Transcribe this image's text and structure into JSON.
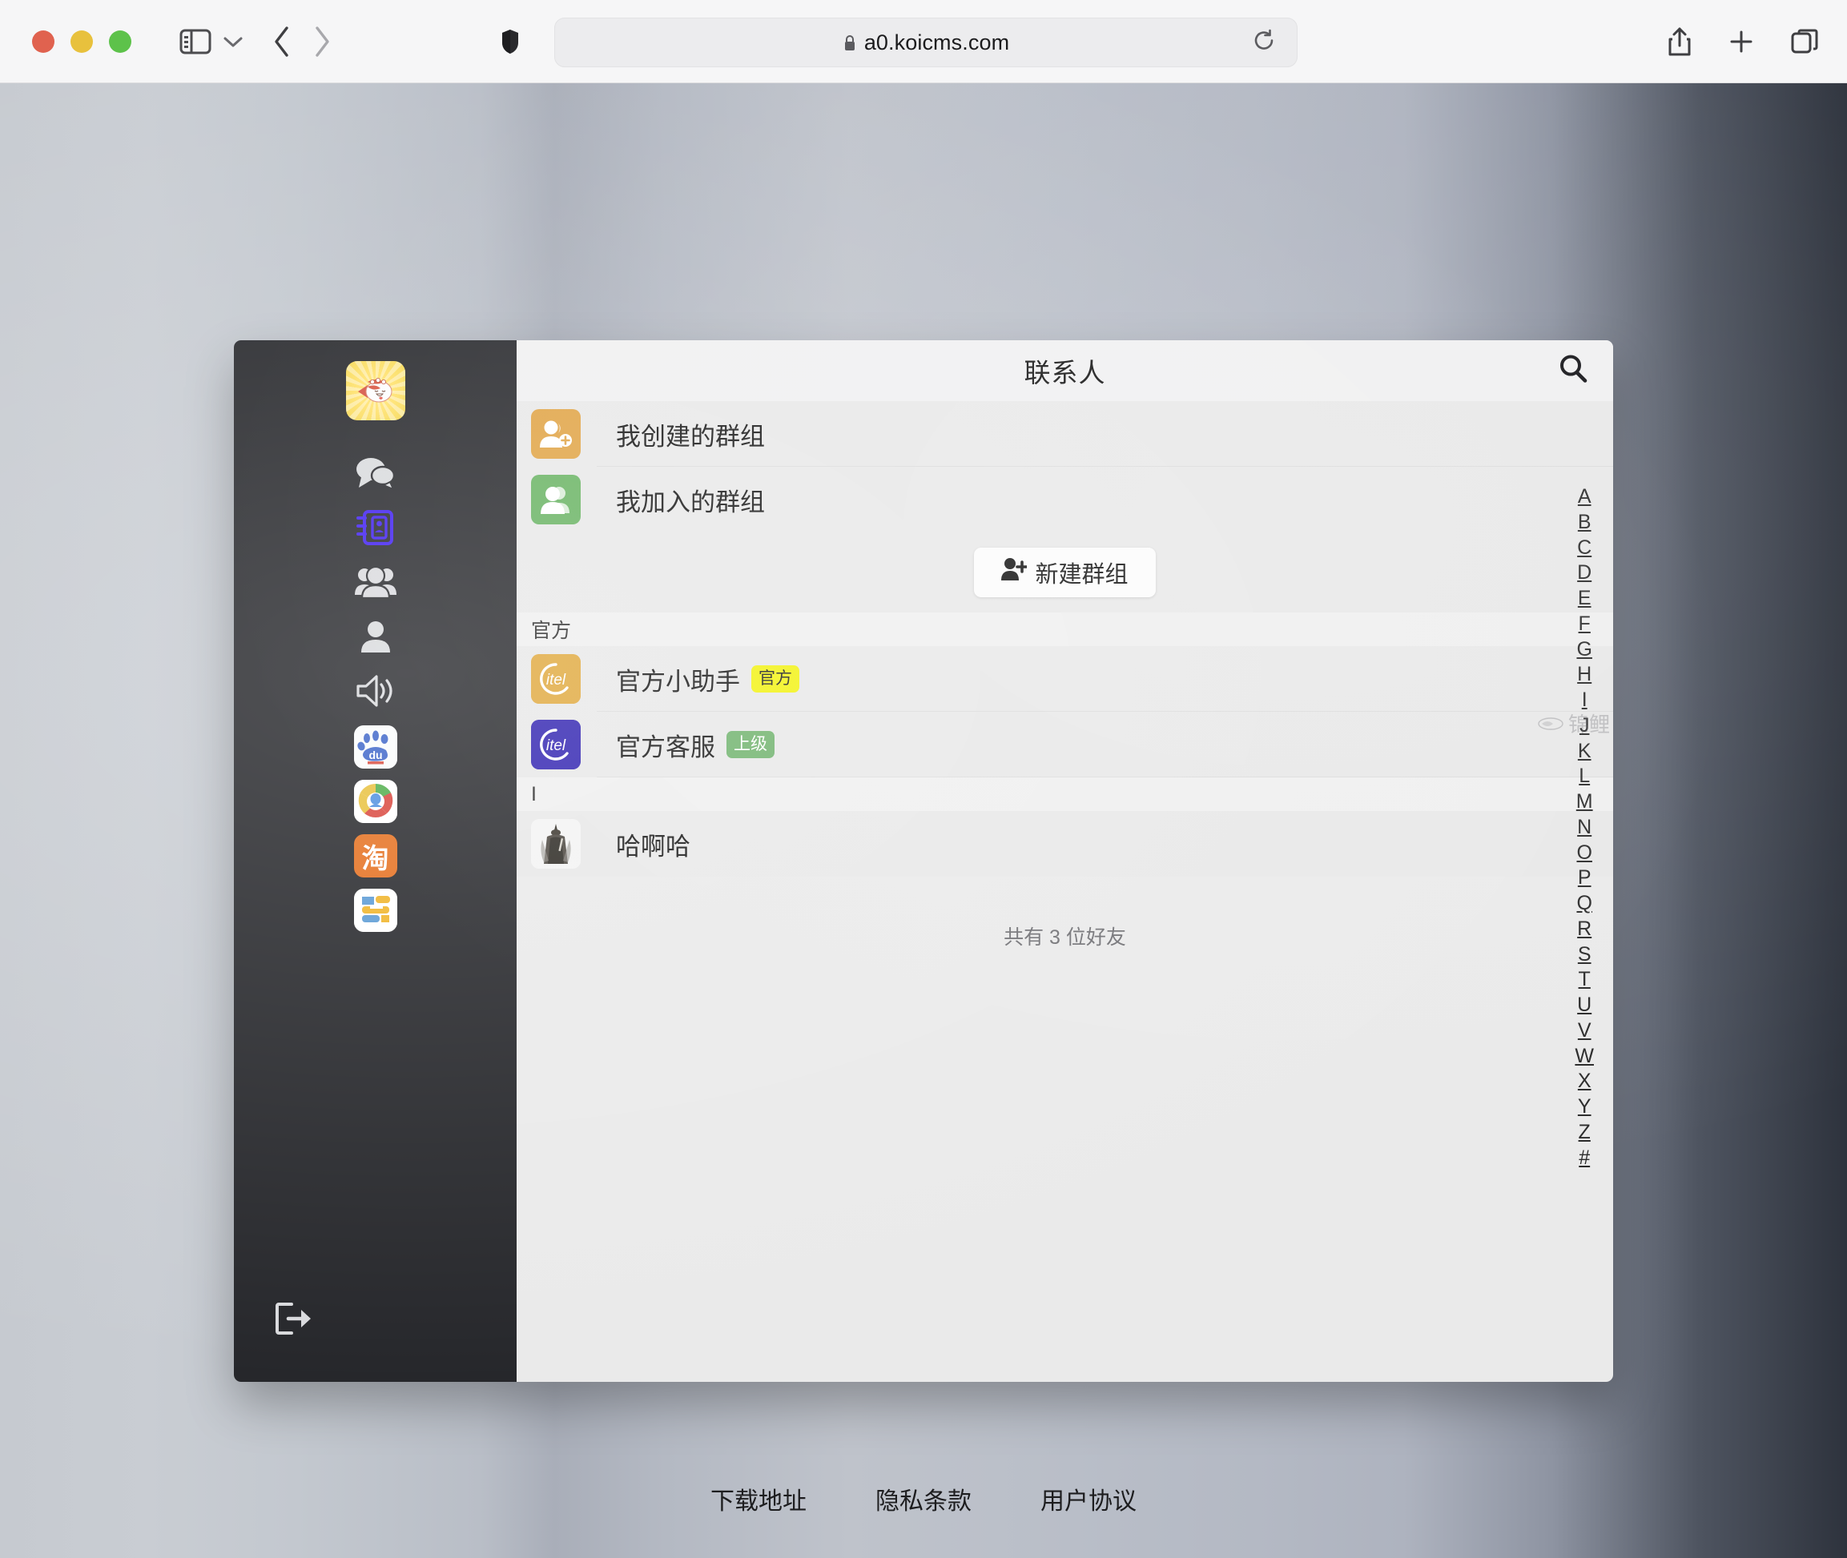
{
  "browser": {
    "url": "a0.koicms.com",
    "lock_icon": "lock-icon",
    "reload_icon": "reload-icon",
    "shield_icon": "shield-icon",
    "sidebar_icon": "sidebar-toggle-icon",
    "back_icon": "back-arrow-icon",
    "forward_icon": "forward-arrow-icon",
    "share_icon": "share-icon",
    "new_tab_icon": "plus-icon",
    "tabs_icon": "tab-overview-icon",
    "traffic_lights": [
      "close-button",
      "minimize-button",
      "zoom-button"
    ]
  },
  "app": {
    "rail": {
      "avatar_name": "koi-fish-avatar",
      "items": [
        {
          "name": "chat-icon",
          "active": false
        },
        {
          "name": "contacts-book-icon",
          "active": true
        },
        {
          "name": "group-icon",
          "active": false
        },
        {
          "name": "profile-icon",
          "active": false
        },
        {
          "name": "speaker-icon",
          "active": false
        }
      ],
      "apps": [
        {
          "name": "baidu-app-icon",
          "label": "du"
        },
        {
          "name": "qq-browser-app-icon",
          "label": ""
        },
        {
          "name": "taobao-app-icon",
          "label": "淘"
        },
        {
          "name": "sina-app-icon",
          "label": ""
        }
      ],
      "logout_icon": "logout-icon"
    },
    "header": {
      "title": "联系人",
      "search_icon": "search-icon"
    },
    "groups": [
      {
        "label": "我创建的群组",
        "avatar": "user-add-icon",
        "color": "orange"
      },
      {
        "label": "我加入的群组",
        "avatar": "users-icon",
        "color": "green"
      }
    ],
    "new_group_button": "新建群组",
    "sections": [
      {
        "heading": "官方",
        "contacts": [
          {
            "name": "官方小助手",
            "badge": "官方",
            "badge_style": "yellow",
            "avatar": "itel-gold-logo"
          },
          {
            "name": "官方客服",
            "badge": "上级",
            "badge_style": "green",
            "avatar": "itel-blue-logo"
          }
        ]
      },
      {
        "heading": "I",
        "contacts": [
          {
            "name": "哈啊哈",
            "badge": "",
            "badge_style": "",
            "avatar": "warrior-photo"
          }
        ]
      }
    ],
    "friend_count_text": "共有 3 位好友",
    "alpha_index": [
      "A",
      "B",
      "C",
      "D",
      "E",
      "F",
      "G",
      "H",
      "I",
      "J",
      "K",
      "L",
      "M",
      "N",
      "O",
      "P",
      "Q",
      "R",
      "S",
      "T",
      "U",
      "V",
      "W",
      "X",
      "Y",
      "Z",
      "#"
    ],
    "watermark": "锦鲤"
  },
  "footer": {
    "links": [
      "下载地址",
      "隐私条款",
      "用户协议"
    ]
  },
  "colors": {
    "rail_bg": "#26272b",
    "panel_bg": "#eaeaea",
    "header_bg": "#f0f0f1",
    "active_icon": "#3e1ef0",
    "badge_yellow": "#f2f20f",
    "badge_green": "#6fb26c",
    "avatar_orange": "#e0a344",
    "avatar_green": "#68b362"
  }
}
